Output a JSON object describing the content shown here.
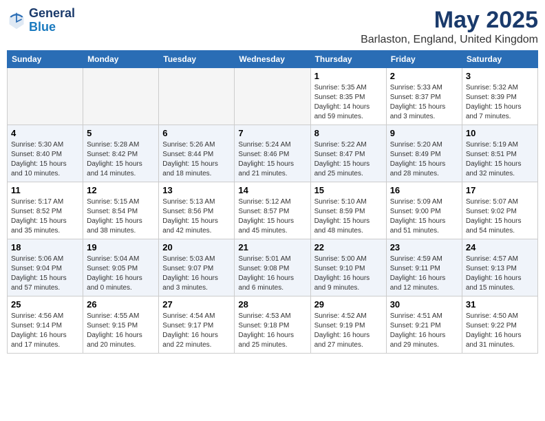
{
  "logo": {
    "line1": "General",
    "line2": "Blue"
  },
  "title": "May 2025",
  "subtitle": "Barlaston, England, United Kingdom",
  "days_of_week": [
    "Sunday",
    "Monday",
    "Tuesday",
    "Wednesday",
    "Thursday",
    "Friday",
    "Saturday"
  ],
  "weeks": [
    [
      {
        "day": "",
        "empty": true
      },
      {
        "day": "",
        "empty": true
      },
      {
        "day": "",
        "empty": true
      },
      {
        "day": "",
        "empty": true
      },
      {
        "day": "1",
        "rise": "5:35 AM",
        "set": "8:35 PM",
        "daylight": "14 hours and 59 minutes."
      },
      {
        "day": "2",
        "rise": "5:33 AM",
        "set": "8:37 PM",
        "daylight": "15 hours and 3 minutes."
      },
      {
        "day": "3",
        "rise": "5:32 AM",
        "set": "8:39 PM",
        "daylight": "15 hours and 7 minutes."
      }
    ],
    [
      {
        "day": "4",
        "rise": "5:30 AM",
        "set": "8:40 PM",
        "daylight": "15 hours and 10 minutes."
      },
      {
        "day": "5",
        "rise": "5:28 AM",
        "set": "8:42 PM",
        "daylight": "15 hours and 14 minutes."
      },
      {
        "day": "6",
        "rise": "5:26 AM",
        "set": "8:44 PM",
        "daylight": "15 hours and 18 minutes."
      },
      {
        "day": "7",
        "rise": "5:24 AM",
        "set": "8:46 PM",
        "daylight": "15 hours and 21 minutes."
      },
      {
        "day": "8",
        "rise": "5:22 AM",
        "set": "8:47 PM",
        "daylight": "15 hours and 25 minutes."
      },
      {
        "day": "9",
        "rise": "5:20 AM",
        "set": "8:49 PM",
        "daylight": "15 hours and 28 minutes."
      },
      {
        "day": "10",
        "rise": "5:19 AM",
        "set": "8:51 PM",
        "daylight": "15 hours and 32 minutes."
      }
    ],
    [
      {
        "day": "11",
        "rise": "5:17 AM",
        "set": "8:52 PM",
        "daylight": "15 hours and 35 minutes."
      },
      {
        "day": "12",
        "rise": "5:15 AM",
        "set": "8:54 PM",
        "daylight": "15 hours and 38 minutes."
      },
      {
        "day": "13",
        "rise": "5:13 AM",
        "set": "8:56 PM",
        "daylight": "15 hours and 42 minutes."
      },
      {
        "day": "14",
        "rise": "5:12 AM",
        "set": "8:57 PM",
        "daylight": "15 hours and 45 minutes."
      },
      {
        "day": "15",
        "rise": "5:10 AM",
        "set": "8:59 PM",
        "daylight": "15 hours and 48 minutes."
      },
      {
        "day": "16",
        "rise": "5:09 AM",
        "set": "9:00 PM",
        "daylight": "15 hours and 51 minutes."
      },
      {
        "day": "17",
        "rise": "5:07 AM",
        "set": "9:02 PM",
        "daylight": "15 hours and 54 minutes."
      }
    ],
    [
      {
        "day": "18",
        "rise": "5:06 AM",
        "set": "9:04 PM",
        "daylight": "15 hours and 57 minutes."
      },
      {
        "day": "19",
        "rise": "5:04 AM",
        "set": "9:05 PM",
        "daylight": "16 hours and 0 minutes."
      },
      {
        "day": "20",
        "rise": "5:03 AM",
        "set": "9:07 PM",
        "daylight": "16 hours and 3 minutes."
      },
      {
        "day": "21",
        "rise": "5:01 AM",
        "set": "9:08 PM",
        "daylight": "16 hours and 6 minutes."
      },
      {
        "day": "22",
        "rise": "5:00 AM",
        "set": "9:10 PM",
        "daylight": "16 hours and 9 minutes."
      },
      {
        "day": "23",
        "rise": "4:59 AM",
        "set": "9:11 PM",
        "daylight": "16 hours and 12 minutes."
      },
      {
        "day": "24",
        "rise": "4:57 AM",
        "set": "9:13 PM",
        "daylight": "16 hours and 15 minutes."
      }
    ],
    [
      {
        "day": "25",
        "rise": "4:56 AM",
        "set": "9:14 PM",
        "daylight": "16 hours and 17 minutes."
      },
      {
        "day": "26",
        "rise": "4:55 AM",
        "set": "9:15 PM",
        "daylight": "16 hours and 20 minutes."
      },
      {
        "day": "27",
        "rise": "4:54 AM",
        "set": "9:17 PM",
        "daylight": "16 hours and 22 minutes."
      },
      {
        "day": "28",
        "rise": "4:53 AM",
        "set": "9:18 PM",
        "daylight": "16 hours and 25 minutes."
      },
      {
        "day": "29",
        "rise": "4:52 AM",
        "set": "9:19 PM",
        "daylight": "16 hours and 27 minutes."
      },
      {
        "day": "30",
        "rise": "4:51 AM",
        "set": "9:21 PM",
        "daylight": "16 hours and 29 minutes."
      },
      {
        "day": "31",
        "rise": "4:50 AM",
        "set": "9:22 PM",
        "daylight": "16 hours and 31 minutes."
      }
    ]
  ]
}
